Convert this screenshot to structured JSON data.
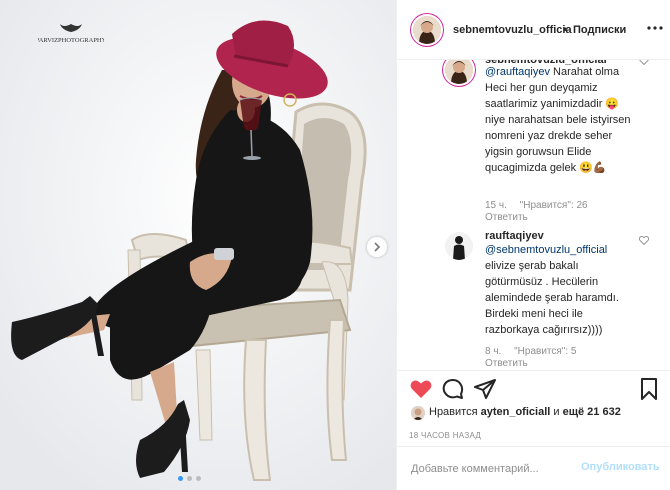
{
  "photo": {
    "watermark": "PARVIZPHOTOGRAPHY",
    "next_icon": "chevron-right-icon",
    "dots_count": 3,
    "active_dot": 0,
    "colors": {
      "hat": "#b0244e",
      "dress": "#161616",
      "chair": "#e8e4dc",
      "backdrop": "#f4f5f7"
    }
  },
  "header": {
    "username": "sebnemtovuzlu_officia",
    "separator": "•",
    "follow_label": "Подписки",
    "more_icon": "more-dots-icon"
  },
  "comments": [
    {
      "username": "sebnemtovuzlu_official",
      "mention": "@rauftaqiyev",
      "text": " Narahat olma Heci her gun deyqamiz saatlarimiz yanimizdadir 😛 niye narahatsan bele istyirsen nomreni yaz drekde seher yigsin goruwsun Elide qucagimizda gelek 😃💪🏾",
      "time": "15 ч.",
      "likes": "\"Нравится\": 26",
      "reply_label": "Ответить"
    },
    {
      "username": "rauftaqiyev",
      "mention": "@sebnemtovuzlu_official",
      "text": "elivize şerab bakalı götürmüsüz . Hecülerin alemindede şerab haramdı. Birdeki meni heci ile razborkaya cağırırsız))))",
      "time": "8 ч.",
      "likes": "\"Нравится\": 5",
      "reply_label": "Ответить"
    }
  ],
  "actions": {
    "like_icon": "heart-filled-icon",
    "comment_icon": "comment-icon",
    "share_icon": "share-icon",
    "save_icon": "bookmark-icon",
    "like_color": "#ed4956"
  },
  "likes": {
    "prefix": "Нравится",
    "user": "ayten_oficiall",
    "connector": "и",
    "count_text": "ещё 21 632"
  },
  "timestamp": "18 ЧАСОВ НАЗАД",
  "add_comment": {
    "placeholder": "Добавьте комментарий...",
    "publish_label": "Опубликовать"
  }
}
